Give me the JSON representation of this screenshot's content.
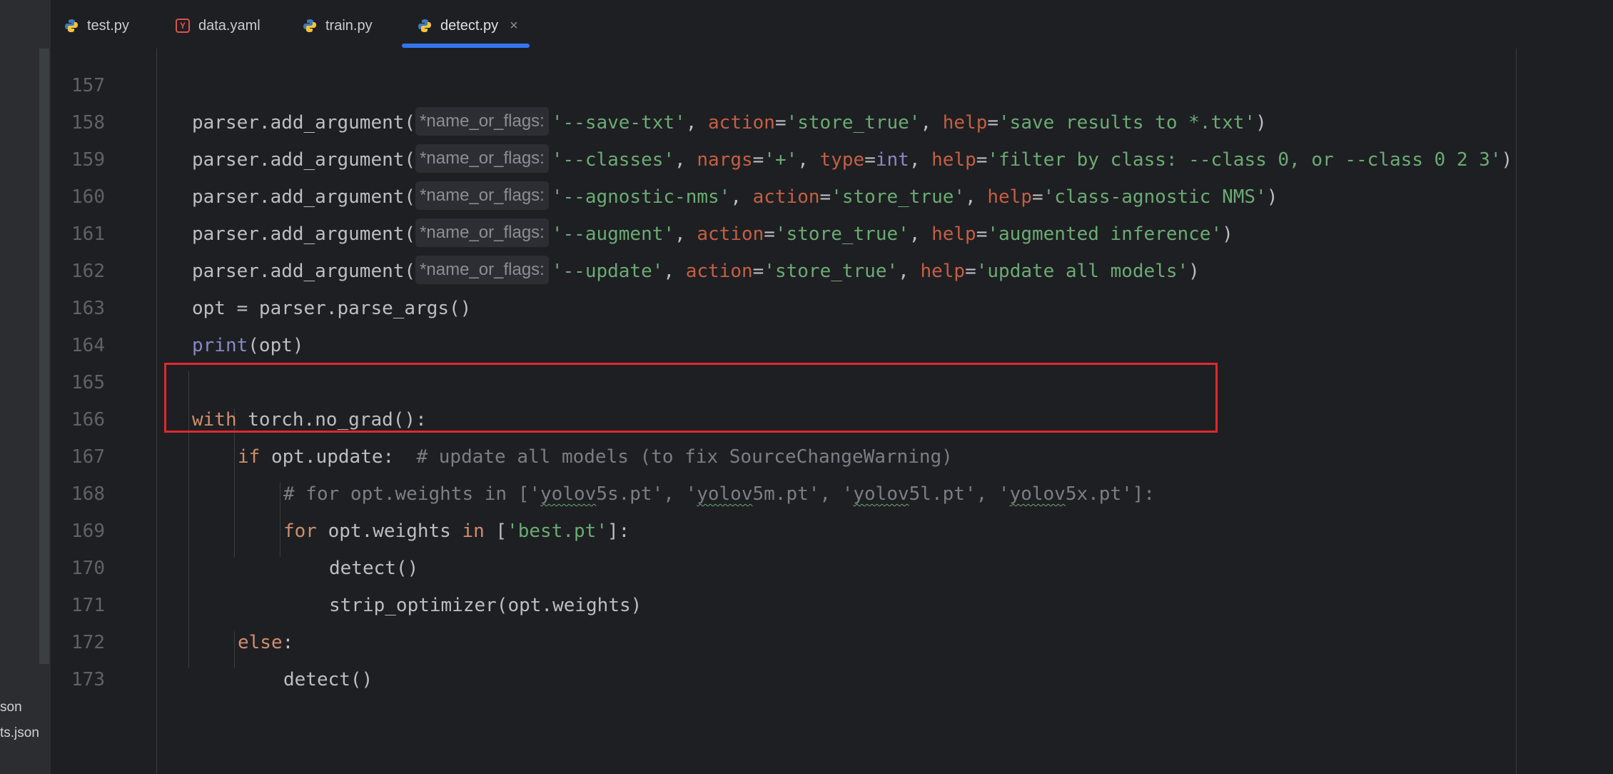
{
  "tabs": [
    {
      "label": "test.py",
      "icon": "python-icon"
    },
    {
      "label": "data.yaml",
      "icon": "yaml-icon"
    },
    {
      "label": "train.py",
      "icon": "python-icon"
    },
    {
      "label": "detect.py",
      "icon": "python-icon",
      "active": true
    }
  ],
  "tab_close": "×",
  "yaml_icon_letter": "Y",
  "tree": {
    "item1": "son",
    "item2": "ts.json"
  },
  "hint_label": "*name_or_flags:",
  "lines": {
    "l157": {
      "num": "157",
      "fn": "parser.add_argument(",
      "a1": "'--save-txt'",
      "k1": "action",
      "v1": "'store_true'",
      "k2": "help",
      "v2": "'save results to *.txt'",
      "end": ")"
    },
    "l158": {
      "num": "158",
      "fn": "parser.add_argument(",
      "a1": "'--classes'",
      "k1": "nargs",
      "v1": "'+'",
      "k2": "type",
      "v2": "int",
      "k3": "help",
      "v3": "'filter by class: --class 0, or --class 0 2 3'",
      "end": ")"
    },
    "l159": {
      "num": "159",
      "fn": "parser.add_argument(",
      "a1": "'--agnostic-nms'",
      "k1": "action",
      "v1": "'store_true'",
      "k2": "help",
      "v2": "'class-agnostic NMS'",
      "end": ")"
    },
    "l160": {
      "num": "160",
      "fn": "parser.add_argument(",
      "a1": "'--augment'",
      "k1": "action",
      "v1": "'store_true'",
      "k2": "help",
      "v2": "'augmented inference'",
      "end": ")"
    },
    "l161": {
      "num": "161",
      "fn": "parser.add_argument(",
      "a1": "'--update'",
      "k1": "action",
      "v1": "'store_true'",
      "k2": "help",
      "v2": "'update all models'",
      "end": ")"
    },
    "l162": {
      "num": "162",
      "text": "opt = parser.parse_args()"
    },
    "l163": {
      "num": "163",
      "fn": "print",
      "rest": "(opt)"
    },
    "l164": {
      "num": "164"
    },
    "l165": {
      "num": "165",
      "kw": "with",
      "rest": " torch.no_grad():"
    },
    "l166": {
      "num": "166",
      "kw": "if",
      "rest": " opt.update:  ",
      "comment": "# update all models (to fix SourceChangeWarning)"
    },
    "l167": {
      "num": "167",
      "c1": "# for opt.weights in ['",
      "w1": "yolov",
      "c2": "5s.pt', '",
      "w2": "yolov",
      "c3": "5m.pt', '",
      "w3": "yolov",
      "c4": "5l.pt', '",
      "w4": "yolov",
      "c5": "5x.pt']:"
    },
    "l168": {
      "num": "168",
      "kw": "for",
      "mid": " opt.weights ",
      "kw2": "in",
      "open": " [",
      "s": "'best.pt'",
      "close": "]:"
    },
    "l169": {
      "num": "169",
      "text": "detect()"
    },
    "l170": {
      "num": "170",
      "text": "strip_optimizer(opt.weights)"
    },
    "l171": {
      "num": "171",
      "kw": "else",
      "rest": ":"
    },
    "l172": {
      "num": "172",
      "text": "detect()"
    },
    "l173": {
      "num": "173"
    }
  },
  "colors": {
    "highlight_box": "#e0282e",
    "active_tab": "#3574f0",
    "background": "#1e1f22"
  }
}
